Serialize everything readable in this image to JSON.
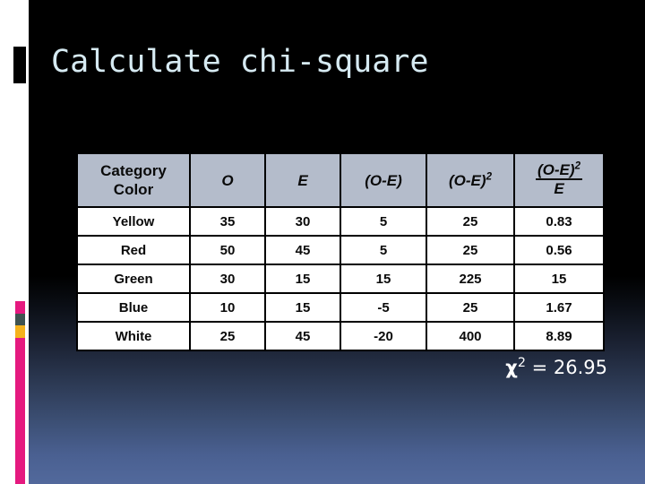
{
  "slide": {
    "title": "Calculate chi-square",
    "background_top_color": "#000000",
    "background_bottom_color": "#52699C",
    "accent_pink": "#E5197F",
    "accent_gold": "#F5B21C",
    "accent_slate": "#3F5350",
    "title_color": "#D6EAF2",
    "header_fill": "#B4BCCB"
  },
  "table": {
    "headers": [
      "Category\nColor",
      "O",
      "E",
      "(O-E)",
      "(O-E)²",
      "(O-E)² / E"
    ],
    "header_parts": {
      "category": "Category",
      "color": "Color",
      "observed": "O",
      "expected": "E",
      "diff": "(O-E)",
      "diff_sq_base": "(O-E)",
      "diff_sq_exp": "2",
      "frac_num_base": "(O-E)",
      "frac_num_exp": "2",
      "frac_den": "E"
    },
    "rows": [
      {
        "category": "Yellow",
        "O": "35",
        "E": "30",
        "O_minus_E": "5",
        "O_minus_E_sq": "25",
        "ratio": "0.83"
      },
      {
        "category": "Red",
        "O": "50",
        "E": "45",
        "O_minus_E": "5",
        "O_minus_E_sq": "25",
        "ratio": "0.56"
      },
      {
        "category": "Green",
        "O": "30",
        "E": "15",
        "O_minus_E": "15",
        "O_minus_E_sq": "225",
        "ratio": "15"
      },
      {
        "category": "Blue",
        "O": "10",
        "E": "15",
        "O_minus_E": "-5",
        "O_minus_E_sq": "25",
        "ratio": "1.67"
      },
      {
        "category": "White",
        "O": "25",
        "E": "45",
        "O_minus_E": "-20",
        "O_minus_E_sq": "400",
        "ratio": "8.89"
      }
    ]
  },
  "result": {
    "symbol": "χ",
    "exponent": "2",
    "equals": " = ",
    "value": "26.95",
    "full": "χ² = 26.95"
  },
  "chart_data": {
    "type": "table",
    "title": "Calculate chi-square",
    "columns": [
      "Category Color",
      "O",
      "E",
      "(O-E)",
      "(O-E)²",
      "(O-E)²/E"
    ],
    "rows": [
      [
        "Yellow",
        35,
        30,
        5,
        25,
        0.83
      ],
      [
        "Red",
        50,
        45,
        5,
        25,
        0.56
      ],
      [
        "Green",
        30,
        15,
        15,
        225,
        15
      ],
      [
        "Blue",
        10,
        15,
        -5,
        25,
        1.67
      ],
      [
        "White",
        25,
        45,
        -20,
        400,
        8.89
      ]
    ],
    "total_label": "χ²",
    "total_value": 26.95
  }
}
